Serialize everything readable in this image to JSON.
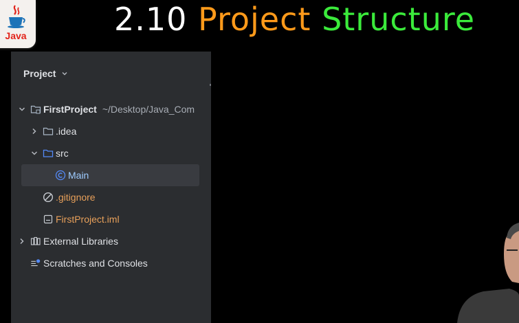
{
  "slide": {
    "title_number": "2.10",
    "title_word1": "Project",
    "title_word2": "Structure",
    "logo_text": "Java"
  },
  "project_panel": {
    "header": "Project",
    "tree": [
      {
        "label": "FirstProject",
        "path": "~/Desktop/Java_Com",
        "expanded": true,
        "icon": "module-folder-icon"
      },
      {
        "label": ".idea",
        "expanded": false,
        "icon": "folder-icon"
      },
      {
        "label": "src",
        "expanded": true,
        "icon": "source-folder-icon"
      },
      {
        "label": "Main",
        "selected": true,
        "icon": "java-class-icon"
      },
      {
        "label": ".gitignore",
        "icon": "ignored-file-icon"
      },
      {
        "label": "FirstProject.iml",
        "icon": "iml-file-icon"
      },
      {
        "label": "External Libraries",
        "expanded": false,
        "icon": "libraries-icon"
      },
      {
        "label": "Scratches and Consoles",
        "icon": "scratches-icon"
      }
    ]
  },
  "colors": {
    "background": "#000000",
    "panel": "#2b2d30",
    "title_number": "#ffffff",
    "title_word1": "#ff9a1a",
    "title_word2": "#3bea3b",
    "modified_file": "#e8a05a",
    "class_name": "#9ecbff"
  }
}
